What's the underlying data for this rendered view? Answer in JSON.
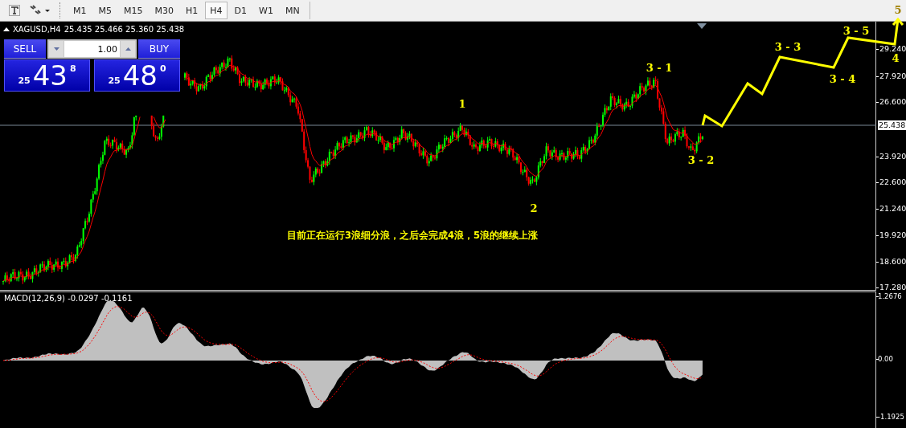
{
  "toolbar": {
    "timeframes": [
      {
        "label": "M1",
        "selected": false
      },
      {
        "label": "M5",
        "selected": false
      },
      {
        "label": "M15",
        "selected": false
      },
      {
        "label": "M30",
        "selected": false
      },
      {
        "label": "H1",
        "selected": false
      },
      {
        "label": "H4",
        "selected": true
      },
      {
        "label": "D1",
        "selected": false
      },
      {
        "label": "W1",
        "selected": false
      },
      {
        "label": "MN",
        "selected": false
      }
    ]
  },
  "chart": {
    "title": "XAGUSD,H4",
    "ohlc": "25.435 25.466 25.360 25.438",
    "trade_panel": {
      "sell_label": "SELL",
      "buy_label": "BUY",
      "lot": "1.00",
      "bid": {
        "prefix": "25",
        "main": "43",
        "suffix": "8"
      },
      "ask": {
        "prefix": "25",
        "main": "48",
        "suffix": "0"
      }
    },
    "price_axis": [
      "29.240",
      "27.920",
      "26.600",
      "23.920",
      "22.600",
      "21.240",
      "19.920",
      "18.600",
      "17.280"
    ],
    "current_price": "25.438",
    "annotations": [
      {
        "text": "1"
      },
      {
        "text": "2"
      },
      {
        "text": "3 - 1"
      },
      {
        "text": "3 - 2"
      },
      {
        "text": "3 - 3"
      },
      {
        "text": "3 - 4"
      },
      {
        "text": "3 - 5"
      },
      {
        "text": "4"
      },
      {
        "text": "5"
      }
    ],
    "note": "目前正在运行3浪细分浪，之后会完成4浪，5浪的继续上涨"
  },
  "macd": {
    "label": "MACD(12,26,9) -0.0297 -0.1161",
    "axis": [
      "1.2676",
      "0.00",
      "-1.1925"
    ]
  }
}
